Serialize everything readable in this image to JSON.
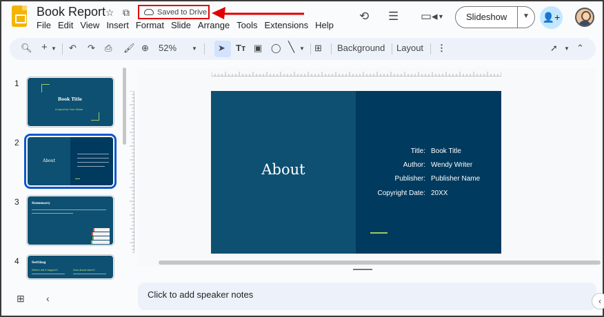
{
  "doc": {
    "title": "Book Report",
    "saved_status": "Saved to Drive"
  },
  "menu": [
    "File",
    "Edit",
    "View",
    "Insert",
    "Format",
    "Slide",
    "Arrange",
    "Tools",
    "Extensions",
    "Help"
  ],
  "header": {
    "slideshow_label": "Slideshow"
  },
  "toolbar": {
    "zoom": "52%",
    "background_label": "Background",
    "layout_label": "Layout"
  },
  "filmstrip": [
    {
      "num": "1",
      "title": "Book Title",
      "subtitle": "A report by Your Name"
    },
    {
      "num": "2",
      "title": "About"
    },
    {
      "num": "3",
      "title": "Summary"
    },
    {
      "num": "4",
      "title": "Setting",
      "col1": "Where did it happen?",
      "col2": "How about when?"
    }
  ],
  "slide": {
    "title": "About",
    "rows": [
      {
        "key": "Title:",
        "value": "Book Title"
      },
      {
        "key": "Author:",
        "value": "Wendy Writer"
      },
      {
        "key": "Publisher:",
        "value": "Publisher Name"
      },
      {
        "key": "Copyright Date:",
        "value": "20XX"
      }
    ]
  },
  "notes": {
    "placeholder": "Click to add speaker notes"
  },
  "colors": {
    "slide_bg": "#0e5071",
    "slide_panel": "#003a5e",
    "accent_green": "#9ccc65",
    "highlight_red": "#e00000",
    "selection_blue": "#0b57d0"
  }
}
